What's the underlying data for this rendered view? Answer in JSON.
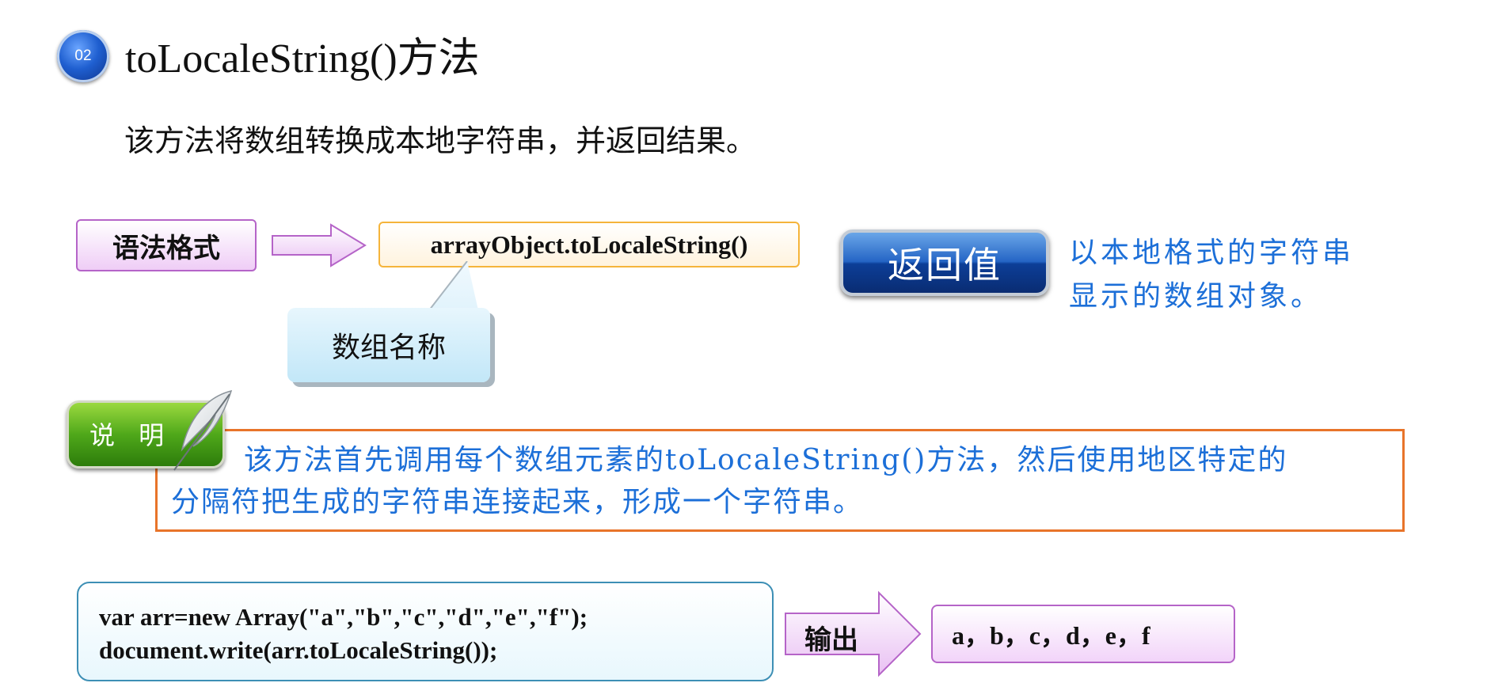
{
  "header": {
    "badge_number": "02",
    "title": "toLocaleString()方法"
  },
  "intro_text": "该方法将数组转换成本地字符串，并返回结果。",
  "syntax": {
    "label": "语法格式",
    "code": "arrayObject.toLocaleString()",
    "callout": "数组名称"
  },
  "return_value": {
    "button_label": "返回值",
    "description_line1": "以本地格式的字符串",
    "description_line2": "显示的数组对象。"
  },
  "note": {
    "label": "说 明",
    "line1": "该方法首先调用每个数组元素的toLocaleString()方法，然后使用地区特定的",
    "line2": "分隔符把生成的字符串连接起来，形成一个字符串。"
  },
  "example": {
    "code_line1": "var arr=new Array(\"a\",\"b\",\"c\",\"d\",\"e\",\"f\");",
    "code_line2": "document.write(arr.toLocaleString());",
    "output_label": "输出",
    "output_value": "a，b，c，d，e，f"
  },
  "colors": {
    "accent_blue_text": "#1c6fd8",
    "note_border": "#e8742a",
    "purple_border": "#b564c8",
    "orange_border": "#f5b43b"
  }
}
